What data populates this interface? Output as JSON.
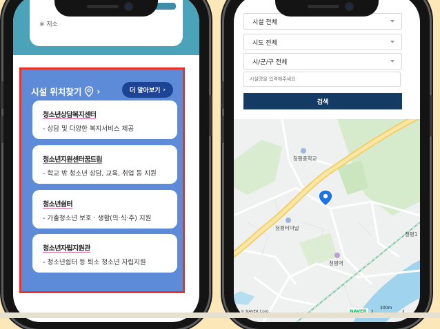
{
  "left_phone": {
    "notice_text": "※ 저소",
    "finder": {
      "title": "시설 위치찾기",
      "title_chevron": "›",
      "more_button": "더 알아보기",
      "more_chevron": "›",
      "cards": [
        {
          "name": "청소년상담복지센터",
          "desc": "-  상담 및 다양한 복지서비스 제공"
        },
        {
          "name": "청소년지원센터꿈드림",
          "desc": "-  학교 밖 청소년 상담, 교육, 취업 등 지원"
        },
        {
          "name": "청소년쉼터",
          "desc": "-  가출청소년 보호 · 생활(의·식·주) 지원"
        },
        {
          "name": "청소년자립지원관",
          "desc": "-  청소년쉼터 등 퇴소 청소년 자립지원"
        }
      ]
    }
  },
  "right_phone": {
    "selects": [
      {
        "label": "시설 전체"
      },
      {
        "label": "시도 전체"
      },
      {
        "label": "시/군/구 전체"
      }
    ],
    "name_placeholder": "시설명을 입력해주세요",
    "search_button": "검색",
    "map": {
      "labels": {
        "school": "청평중학교",
        "terminal": "청평터미널",
        "station": "청평역",
        "east": "청평1"
      },
      "copyright": "© NAVER Corp.",
      "brand": "NAVER",
      "scale": "300m"
    }
  },
  "colors": {
    "background": "#fbe7b8",
    "finder_blue": "#5d8bd8",
    "highlight_red": "#e5352b",
    "button_navy": "#1d4396",
    "search_navy": "#143b64",
    "teal": "#4ba3b9"
  }
}
